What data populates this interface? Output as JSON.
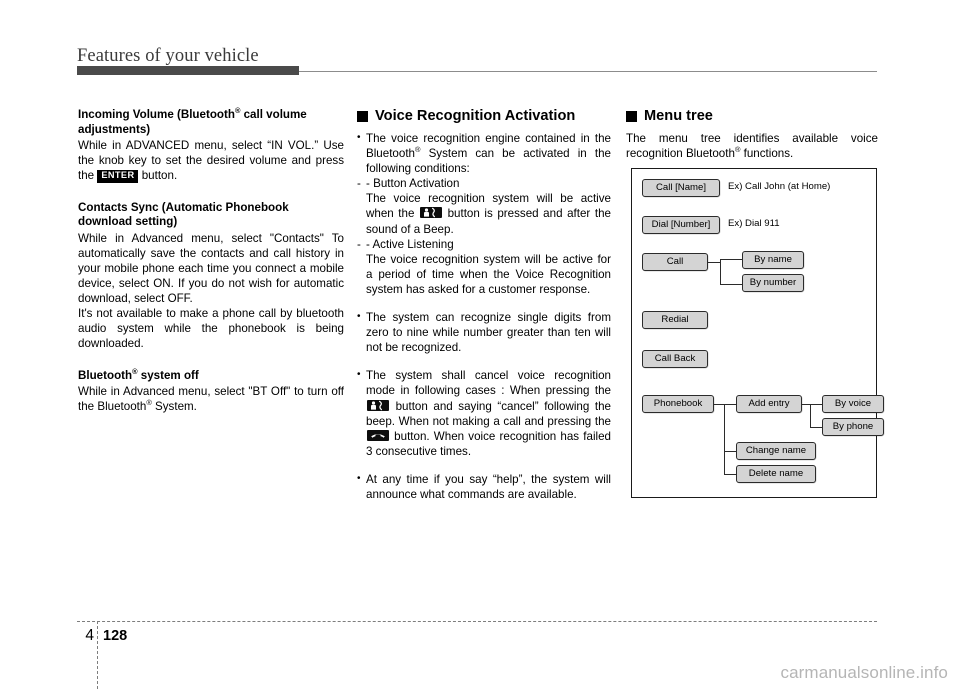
{
  "header": {
    "title": "Features of your vehicle"
  },
  "column1": {
    "section1": {
      "heading_part1": "Incoming Volume (Bluetooth",
      "heading_reg": "®",
      "heading_part2": " call volume adjustments)",
      "para_part1": "While in ADVANCED menu, select “IN VOL.” Use the knob key to set the desired volume and press the ",
      "key_label": "ENTER",
      "para_part2": " button."
    },
    "section2": {
      "heading": "Contacts Sync (Automatic Phonebook download setting)",
      "para1": "While in Advanced menu, select \"Contacts\" To automatically save the contacts and call history in your mobile phone each time you connect a mobile device, select ON. If you do not wish for automatic download, select OFF.",
      "para2": "It's not  available to make a phone call by bluetooth audio system while the phonebook is being downloaded."
    },
    "section3": {
      "heading_part1": "Bluetooth",
      "heading_reg": "®",
      "heading_part2": " system off",
      "para_part1": "While in Advanced menu, select \"BT Off\" to turn off the Bluetooth",
      "para_reg": "®",
      "para_part2": " System."
    }
  },
  "column2": {
    "heading": "Voice Recognition Activation",
    "bullet1": {
      "text_part1": "The voice recognition engine contained in the Bluetooth",
      "reg": "®",
      "text_part2": " System can be activated in the following conditions:"
    },
    "sub1": {
      "label": "- Button Activation",
      "text_part1": "The voice recognition system will be active when the ",
      "icon": "voice-recognition-icon",
      "text_part2": " button is pressed and after the sound of a Beep."
    },
    "sub2": {
      "label": "- Active Listening",
      "text": "The voice recognition system will be active for a period of time when the Voice Recognition system has asked for a customer response."
    },
    "bullet2": "The system can recognize single digits from zero to nine while number greater than ten will not be recognized.",
    "bullet3": {
      "text_part1": "The system shall cancel voice recognition mode in following cases : When pressing the ",
      "icon1": "voice-recognition-icon",
      "text_part2": " button and saying “cancel” following the beep. When not making a call and pressing the ",
      "icon2": "end-call-icon",
      "text_part3": " button. When voice recognition has failed 3 consecutive times."
    },
    "bullet4": "At any time if you say “help”, the system will announce what commands are available."
  },
  "column3": {
    "heading": "Menu tree",
    "intro_part1": "The menu tree identifies available voice recognition Bluetooth",
    "intro_reg": "®",
    "intro_part2": " functions.",
    "tree": {
      "nodes": [
        {
          "id": "call_name",
          "label": "Call [Name]"
        },
        {
          "id": "dial_number",
          "label": "Dial [Number]"
        },
        {
          "id": "call",
          "label": "Call"
        },
        {
          "id": "by_name",
          "label": "By name"
        },
        {
          "id": "by_number",
          "label": "By number"
        },
        {
          "id": "redial",
          "label": "Redial"
        },
        {
          "id": "call_back",
          "label": "Call Back"
        },
        {
          "id": "phonebook",
          "label": "Phonebook"
        },
        {
          "id": "add_entry",
          "label": "Add entry"
        },
        {
          "id": "by_voice",
          "label": "By voice"
        },
        {
          "id": "by_phone",
          "label": "By phone"
        },
        {
          "id": "change_name",
          "label": "Change name"
        },
        {
          "id": "delete_name",
          "label": "Delete name"
        }
      ],
      "examples": [
        {
          "id": "ex_call_name",
          "label": "Ex) Call John (at Home)"
        },
        {
          "id": "ex_dial_number",
          "label": "Ex) Dial 911"
        }
      ]
    }
  },
  "footer": {
    "chapter": "4",
    "page": "128",
    "watermark": "carmanualsonline.info"
  },
  "colors": {
    "header_rule": "#4a4a4a",
    "node_fill": "#d4d4d4",
    "node_border": "#2b2b2b",
    "watermark": "#b5b5b5"
  }
}
